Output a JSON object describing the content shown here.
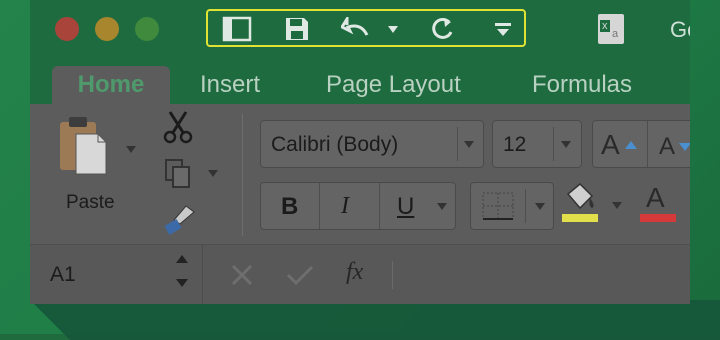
{
  "window": {
    "title": "GoSl"
  },
  "quick_access": {
    "items": [
      "sidebar-icon",
      "save-icon",
      "undo-icon",
      "undo-dropdown-icon",
      "redo-icon",
      "customize-toolbar-icon"
    ]
  },
  "tabs": [
    {
      "label": "Home"
    },
    {
      "label": "Insert"
    },
    {
      "label": "Page Layout"
    },
    {
      "label": "Formulas"
    }
  ],
  "ribbon": {
    "paste_label": "Paste",
    "font_name": "Calibri (Body)",
    "font_size": "12",
    "bold": "B",
    "italic": "I",
    "underline": "U",
    "grow_font": "A",
    "shrink_font": "A",
    "font_color_glyph": "A",
    "fill_color": "#e2e04a",
    "font_color": "#d6393a"
  },
  "formula_bar": {
    "name_box": "A1",
    "fx": "fx"
  },
  "colors": {
    "accent": "#1e6b40",
    "qat_highlight": "#e0e234"
  }
}
